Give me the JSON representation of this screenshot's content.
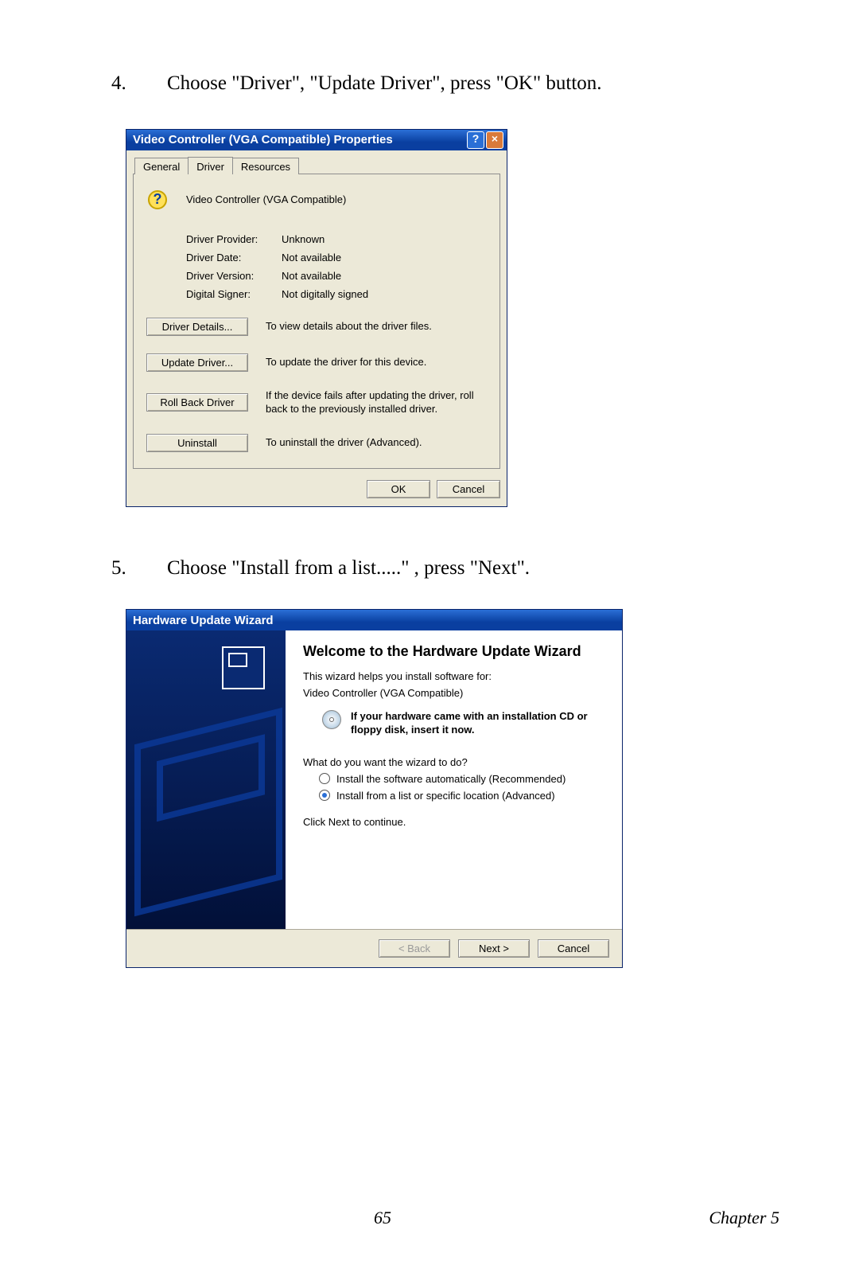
{
  "steps": {
    "s4": {
      "num": "4.",
      "text": "Choose \"Driver\", \"Update Driver\", press \"OK\" button."
    },
    "s5": {
      "num": "5.",
      "text": "Choose \"Install from a list.....\" , press \"Next\"."
    }
  },
  "props": {
    "title": "Video Controller (VGA Compatible) Properties",
    "tabs": {
      "general": "General",
      "driver": "Driver",
      "resources": "Resources"
    },
    "device_name": "Video Controller (VGA Compatible)",
    "rows": {
      "provider_k": "Driver Provider:",
      "provider_v": "Unknown",
      "date_k": "Driver Date:",
      "date_v": "Not available",
      "version_k": "Driver Version:",
      "version_v": "Not available",
      "signer_k": "Digital Signer:",
      "signer_v": "Not digitally signed"
    },
    "actions": {
      "details_btn": "Driver Details...",
      "details_desc": "To view details about the driver files.",
      "update_btn": "Update Driver...",
      "update_desc": "To update the driver for this device.",
      "rollback_btn": "Roll Back Driver",
      "rollback_desc": "If the device fails after updating the driver, roll back to the previously installed driver.",
      "uninstall_btn": "Uninstall",
      "uninstall_desc": "To uninstall the driver (Advanced)."
    },
    "ok": "OK",
    "cancel": "Cancel"
  },
  "wizard": {
    "title": "Hardware Update Wizard",
    "header": "Welcome to the Hardware Update Wizard",
    "intro": "This wizard helps you install software for:",
    "device": "Video Controller (VGA Compatible)",
    "cd_hint": "If your hardware came with an installation CD or floppy disk, insert it now.",
    "question": "What do you want the wizard to do?",
    "opt_auto": "Install the software automatically (Recommended)",
    "opt_list": "Install from a list or specific location (Advanced)",
    "continue": "Click Next to continue.",
    "back": "< Back",
    "next": "Next >",
    "cancel": "Cancel"
  },
  "footer": {
    "page": "65",
    "chapter": "Chapter 5"
  }
}
